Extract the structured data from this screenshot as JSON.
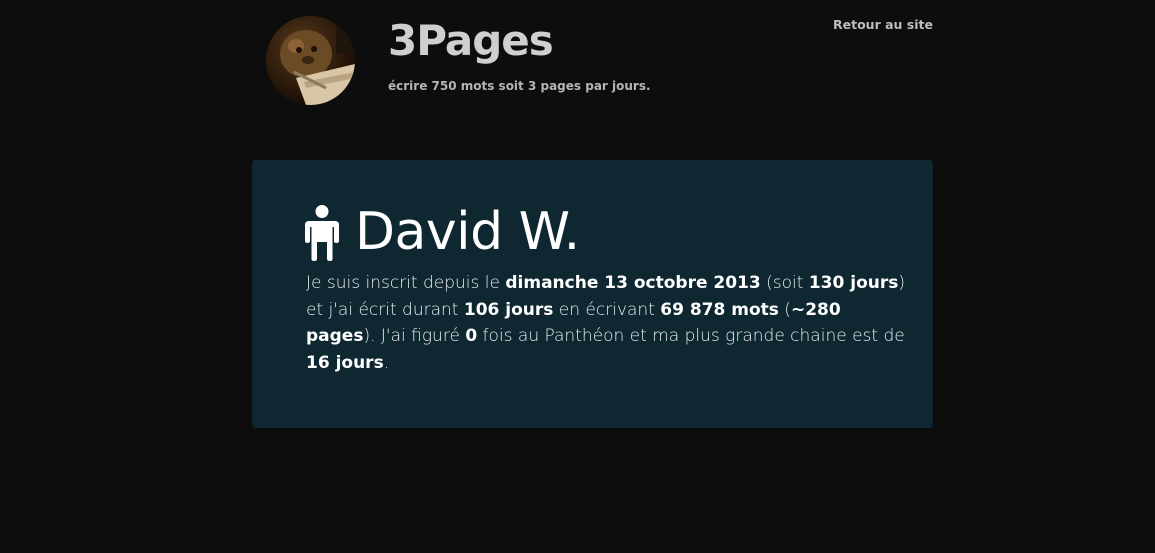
{
  "header": {
    "site_title": "3Pages",
    "tagline": "écrire 750 mots soit 3 pages par jours.",
    "back_link": "Retour au site",
    "avatar_icon": "avatar-photo"
  },
  "profile": {
    "icon": "user-icon",
    "name": "David W.",
    "stats": {
      "t1": "Je suis inscrit depuis le ",
      "signup_date": "dimanche 13 octobre 2013",
      "t2": " (soit ",
      "days_since": "130 jours",
      "t3": ") et j'ai écrit durant ",
      "days_written": "106 jours",
      "t4": " en écrivant ",
      "word_count": "69 878 mots",
      "t5": " (",
      "page_count": "~280 pages",
      "t6": "). J'ai figuré ",
      "pantheon_count": "0",
      "t7": " fois au Panthéon et ma plus grande chaine est de ",
      "longest_chain": "16 jours",
      "t8": "."
    }
  },
  "colors": {
    "background": "#0d0d0d",
    "card": "#0e2730",
    "text": "#ffffff"
  }
}
